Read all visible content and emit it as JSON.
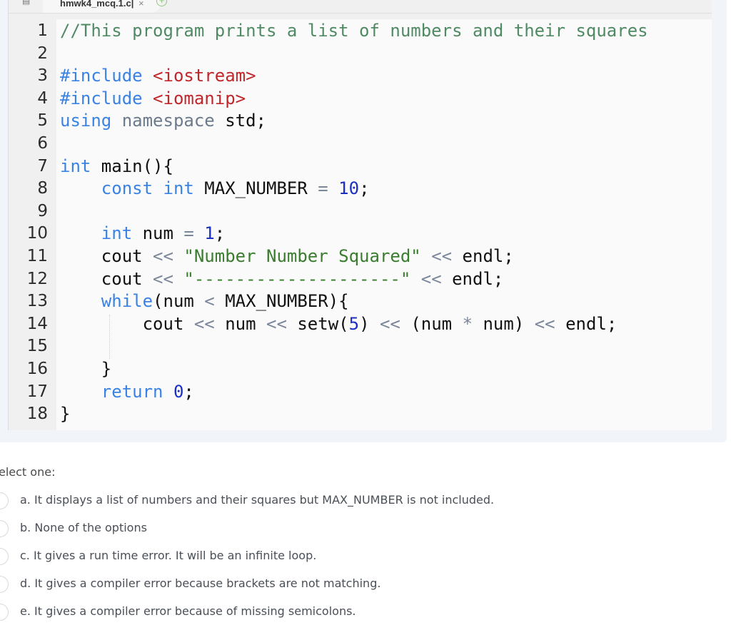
{
  "browser": {
    "tab_title": "hmwk4_mcq.1.c|",
    "tab_close_icon": "×",
    "new_tab_icon": "+",
    "folder_icon": "▤"
  },
  "code": {
    "line_numbers": [
      "1",
      "2",
      "3",
      "4",
      "5",
      "6",
      "7",
      "8",
      "9",
      "10",
      "11",
      "12",
      "13",
      "14",
      "15",
      "16",
      "17",
      "18"
    ],
    "lines": [
      [
        {
          "t": "//This program prints a list of numbers and their squares",
          "c": "cm"
        }
      ],
      [],
      [
        {
          "t": "#include ",
          "c": "kw"
        },
        {
          "t": "<iostream>",
          "c": "inc"
        }
      ],
      [
        {
          "t": "#include ",
          "c": "kw"
        },
        {
          "t": "<iomanip>",
          "c": "inc"
        }
      ],
      [
        {
          "t": "using ",
          "c": "kw"
        },
        {
          "t": "namespace ",
          "c": "kw2"
        },
        {
          "t": "std;",
          "c": ""
        }
      ],
      [],
      [
        {
          "t": "int ",
          "c": "kw"
        },
        {
          "t": "main(){",
          "c": ""
        }
      ],
      [
        {
          "t": "    ",
          "c": ""
        },
        {
          "t": "const ",
          "c": "kw"
        },
        {
          "t": "int ",
          "c": "kw"
        },
        {
          "t": "MAX_NUMBER ",
          "c": ""
        },
        {
          "t": "= ",
          "c": "op"
        },
        {
          "t": "10",
          "c": "num"
        },
        {
          "t": ";",
          "c": ""
        }
      ],
      [],
      [
        {
          "t": "    ",
          "c": ""
        },
        {
          "t": "int ",
          "c": "kw"
        },
        {
          "t": "num ",
          "c": ""
        },
        {
          "t": "= ",
          "c": "op"
        },
        {
          "t": "1",
          "c": "num"
        },
        {
          "t": ";",
          "c": ""
        }
      ],
      [
        {
          "t": "    cout ",
          "c": ""
        },
        {
          "t": "<< ",
          "c": "op"
        },
        {
          "t": "\"Number Number Squared\" ",
          "c": "str"
        },
        {
          "t": "<< ",
          "c": "op"
        },
        {
          "t": "endl;",
          "c": ""
        }
      ],
      [
        {
          "t": "    cout ",
          "c": ""
        },
        {
          "t": "<< ",
          "c": "op"
        },
        {
          "t": "\"--------------------\" ",
          "c": "str"
        },
        {
          "t": "<< ",
          "c": "op"
        },
        {
          "t": "endl;",
          "c": ""
        }
      ],
      [
        {
          "t": "    ",
          "c": ""
        },
        {
          "t": "while",
          "c": "kw"
        },
        {
          "t": "(num ",
          "c": ""
        },
        {
          "t": "< ",
          "c": "op"
        },
        {
          "t": "MAX_NUMBER){",
          "c": ""
        }
      ],
      [
        {
          "t": "        cout ",
          "c": ""
        },
        {
          "t": "<< ",
          "c": "op"
        },
        {
          "t": "num ",
          "c": ""
        },
        {
          "t": "<< ",
          "c": "op"
        },
        {
          "t": "setw(",
          "c": ""
        },
        {
          "t": "5",
          "c": "num"
        },
        {
          "t": ") ",
          "c": ""
        },
        {
          "t": "<< ",
          "c": "op"
        },
        {
          "t": "(num ",
          "c": ""
        },
        {
          "t": "* ",
          "c": "op"
        },
        {
          "t": "num) ",
          "c": ""
        },
        {
          "t": "<< ",
          "c": "op"
        },
        {
          "t": "endl;",
          "c": ""
        }
      ],
      [],
      [
        {
          "t": "    }",
          "c": ""
        }
      ],
      [
        {
          "t": "    ",
          "c": ""
        },
        {
          "t": "return ",
          "c": "kw"
        },
        {
          "t": "0",
          "c": "num"
        },
        {
          "t": ";",
          "c": ""
        }
      ],
      [
        {
          "t": "}",
          "c": ""
        }
      ]
    ]
  },
  "question": {
    "prompt": "elect one:",
    "options": [
      {
        "label": "a. It displays a list of numbers and their squares but MAX_NUMBER is not included.",
        "selected": false
      },
      {
        "label": "b. None of the options",
        "selected": false
      },
      {
        "label": "c. It gives a run time error. It will be an infinite loop.",
        "selected": false
      },
      {
        "label": "d. It gives a compiler error because brackets are not matching.",
        "selected": false
      },
      {
        "label": "e. It gives a compiler error because of missing semicolons.",
        "selected": false
      }
    ]
  }
}
